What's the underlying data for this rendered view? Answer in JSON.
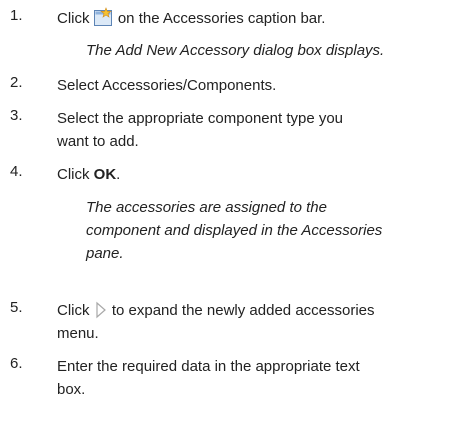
{
  "steps": [
    {
      "number": "1.",
      "before": "Click",
      "icon": "add-new-accessory-icon",
      "after": "on the Accessories caption bar.",
      "note": "The Add New Accessory dialog box displays."
    },
    {
      "number": "2.",
      "text": "Select Accessories/Components."
    },
    {
      "number": "3.",
      "line1": "Select the appropriate component type you",
      "line2": "want to add."
    },
    {
      "number": "4.",
      "before": "Click ",
      "bold": "OK",
      "after": ".",
      "note_lines": [
        "The accessories are assigned to the",
        "component and displayed in the Accessories",
        "pane."
      ]
    },
    {
      "number": "5.",
      "before": "Click",
      "icon": "expand-arrow-icon",
      "after": "to expand the newly added accessories",
      "line2": "menu."
    },
    {
      "number": "6.",
      "line1": "Enter the required data in the appropriate text",
      "line2": "box."
    }
  ]
}
